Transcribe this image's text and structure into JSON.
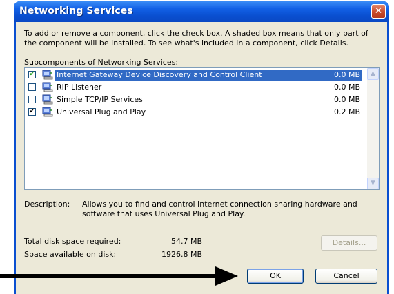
{
  "window": {
    "title": "Networking Services",
    "close_glyph": "✕"
  },
  "intro_text": "To add or remove a component, click the check box. A shaded box means that only part of the component will be installed. To see what's included in a component, click Details.",
  "subcomponents": {
    "label": "Subcomponents of Networking Services:",
    "items": [
      {
        "label": "Internet Gateway Device Discovery and Control Client",
        "size": "0.0 MB",
        "checked": true,
        "selected": true,
        "icon": "network-computer-icon"
      },
      {
        "label": "RIP Listener",
        "size": "0.0 MB",
        "checked": false,
        "selected": false,
        "icon": "network-computer-icon"
      },
      {
        "label": "Simple TCP/IP Services",
        "size": "0.0 MB",
        "checked": false,
        "selected": false,
        "icon": "network-computer-icon"
      },
      {
        "label": "Universal Plug and Play",
        "size": "0.2 MB",
        "checked": true,
        "selected": false,
        "icon": "network-computer-icon"
      }
    ]
  },
  "description": {
    "label": "Description:",
    "text": "Allows you to find and control Internet connection sharing hardware and software that uses Universal Plug and Play."
  },
  "disk": {
    "required_label": "Total disk space required:",
    "required_value": "54.7 MB",
    "available_label": "Space available on disk:",
    "available_value": "1926.8 MB"
  },
  "buttons": {
    "details": "Details...",
    "ok": "OK",
    "cancel": "Cancel"
  },
  "colors": {
    "title_bar": "#0a4fd0",
    "selection": "#316ac5",
    "face": "#ece9d8"
  }
}
